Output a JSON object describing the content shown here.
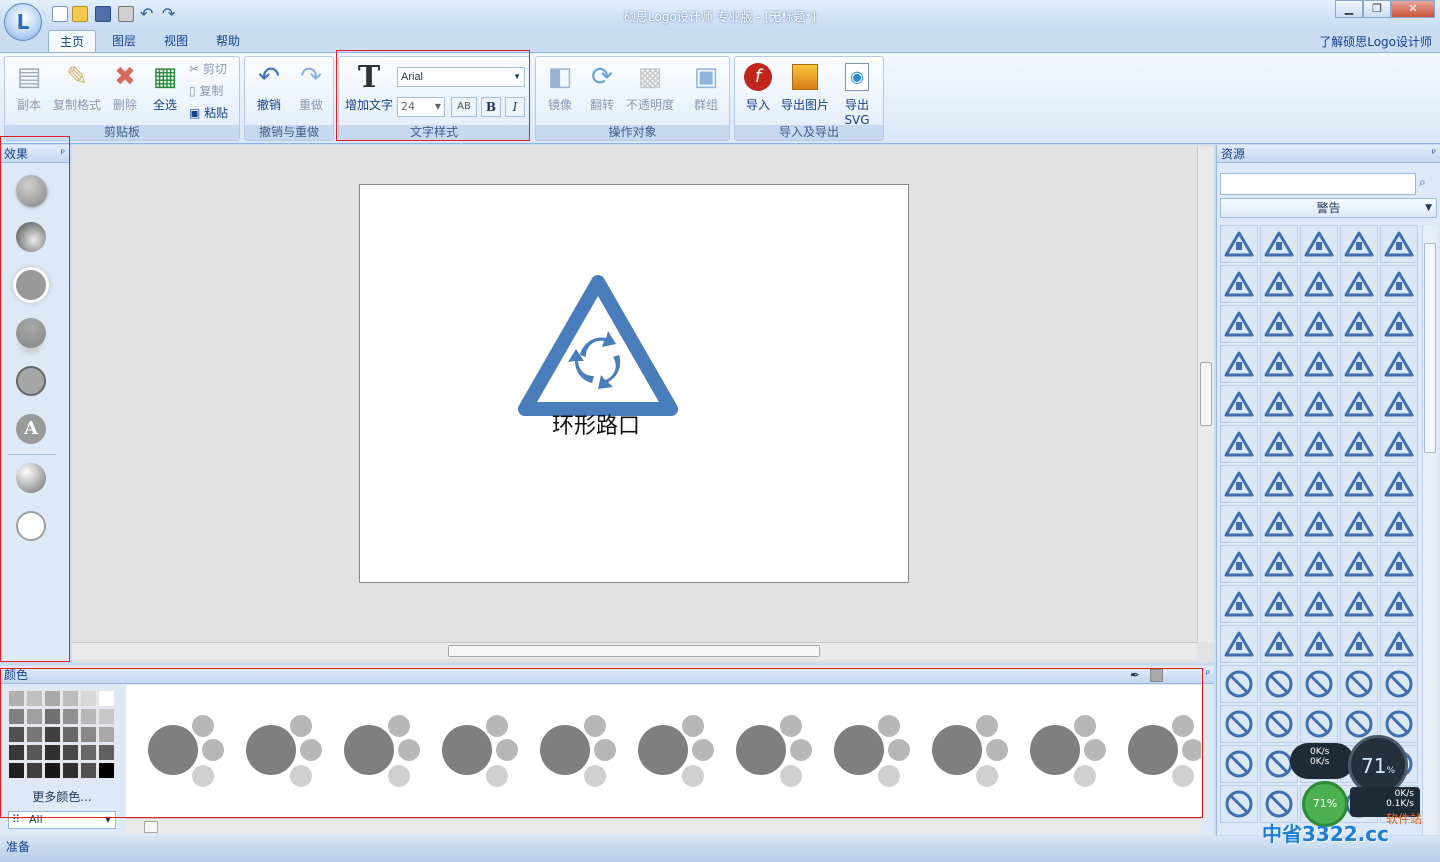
{
  "app": {
    "title": "硕思Logo设计师 专业版 - [无标题*]",
    "about_link": "了解硕思Logo设计师"
  },
  "quick_access": [
    "new-icon",
    "open-icon",
    "save-icon",
    "print-icon",
    "undo-icon",
    "redo-icon"
  ],
  "tabs": [
    {
      "label": "主页",
      "active": true
    },
    {
      "label": "图层"
    },
    {
      "label": "视图"
    },
    {
      "label": "帮助"
    }
  ],
  "ribbon": {
    "clipboard": {
      "label": "剪贴板",
      "copy": "副本",
      "format_painter": "复制格式",
      "delete": "删除",
      "select_all": "全选",
      "cut": "剪切",
      "copy2": "复制",
      "paste": "粘贴"
    },
    "undo_redo": {
      "label": "撤销与重做",
      "undo": "撤销",
      "redo": "重做"
    },
    "text": {
      "label": "文字样式",
      "add_text": "增加文字",
      "font": "Arial",
      "size": "24",
      "ab": "AB",
      "bold": "B",
      "italic": "I"
    },
    "operations": {
      "label": "操作对象",
      "mirror": "镜像",
      "flip": "翻转",
      "opacity": "不透明度",
      "group": "群组"
    },
    "io": {
      "label": "导入及导出",
      "import": "导入",
      "export_image": "导出图片",
      "export_svg": "导出SVG"
    }
  },
  "effects_panel": {
    "title": "效果"
  },
  "canvas": {
    "logo_text": "环形路口"
  },
  "resources_panel": {
    "title": "资源",
    "category": "警告"
  },
  "colors_panel": {
    "title": "颜色",
    "more_colors": "更多颜色...",
    "filter": "All"
  },
  "status": {
    "text": "准备"
  },
  "net_widget": {
    "upload": "0K/s",
    "download": "0K/s",
    "cpu": "71",
    "percent": "%",
    "up2": "0K/s",
    "down2": "0.1K/s",
    "mem": "71%"
  },
  "watermark": {
    "site": "中省3322.cc",
    "label": "软件站"
  },
  "colors": {
    "accent": "#4a7dbb",
    "ribbon": "#dbe7f6",
    "red_outline": "#e02020"
  }
}
